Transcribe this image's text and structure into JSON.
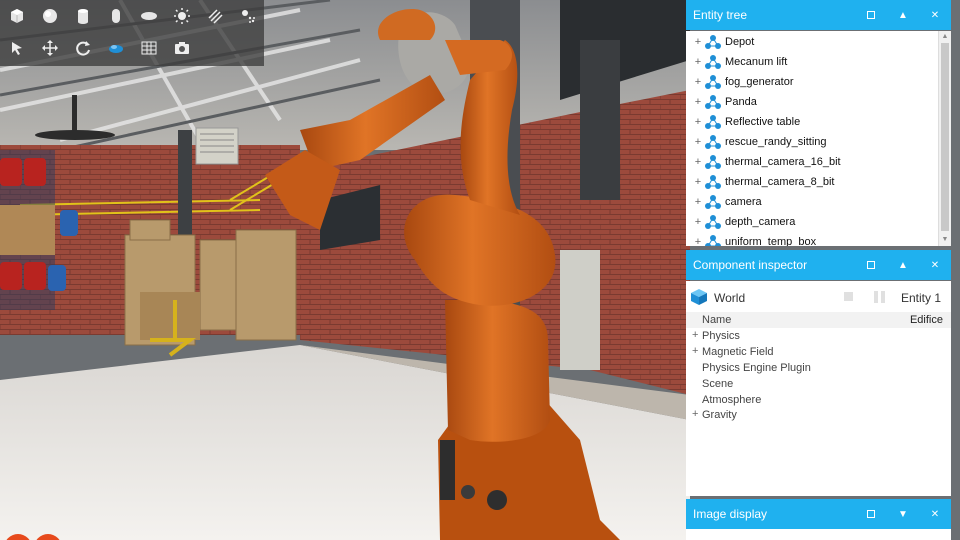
{
  "toolbar": {
    "row1": [
      "box-icon",
      "sphere-icon",
      "cylinder-icon",
      "capsule-icon",
      "ellipsoid-icon",
      "sun-icon",
      "directional-light-icon",
      "spot-light-icon"
    ],
    "row2": [
      "select-arrow-icon",
      "translate-icon",
      "rotate-icon",
      "scale-icon",
      "grid-icon",
      "camera-icon"
    ]
  },
  "entity_tree": {
    "title": "Entity tree",
    "items": [
      {
        "label": "Depot"
      },
      {
        "label": "Mecanum lift"
      },
      {
        "label": "fog_generator"
      },
      {
        "label": "Panda"
      },
      {
        "label": "Reflective table"
      },
      {
        "label": "rescue_randy_sitting"
      },
      {
        "label": "thermal_camera_16_bit"
      },
      {
        "label": "thermal_camera_8_bit"
      },
      {
        "label": "camera"
      },
      {
        "label": "depth_camera"
      },
      {
        "label": "uniform_temp_box"
      }
    ]
  },
  "component_inspector": {
    "title": "Component inspector",
    "entity_name": "World",
    "entity_label": "Entity 1",
    "rows": [
      {
        "key": "Name",
        "value": "Edifice",
        "expandable": false
      },
      {
        "key": "Physics",
        "value": "",
        "expandable": true
      },
      {
        "key": "Magnetic Field",
        "value": "",
        "expandable": true
      },
      {
        "key": "Physics Engine Plugin",
        "value": "",
        "expandable": false
      },
      {
        "key": "Scene",
        "value": "",
        "expandable": false
      },
      {
        "key": "Atmosphere",
        "value": "",
        "expandable": false
      },
      {
        "key": "Gravity",
        "value": "",
        "expandable": true
      }
    ]
  },
  "image_display": {
    "title": "Image display"
  },
  "colors": {
    "panel_header": "#1fb1ef",
    "robot_orange": "#d8661a",
    "entity_icon": "#1f8fd6"
  }
}
